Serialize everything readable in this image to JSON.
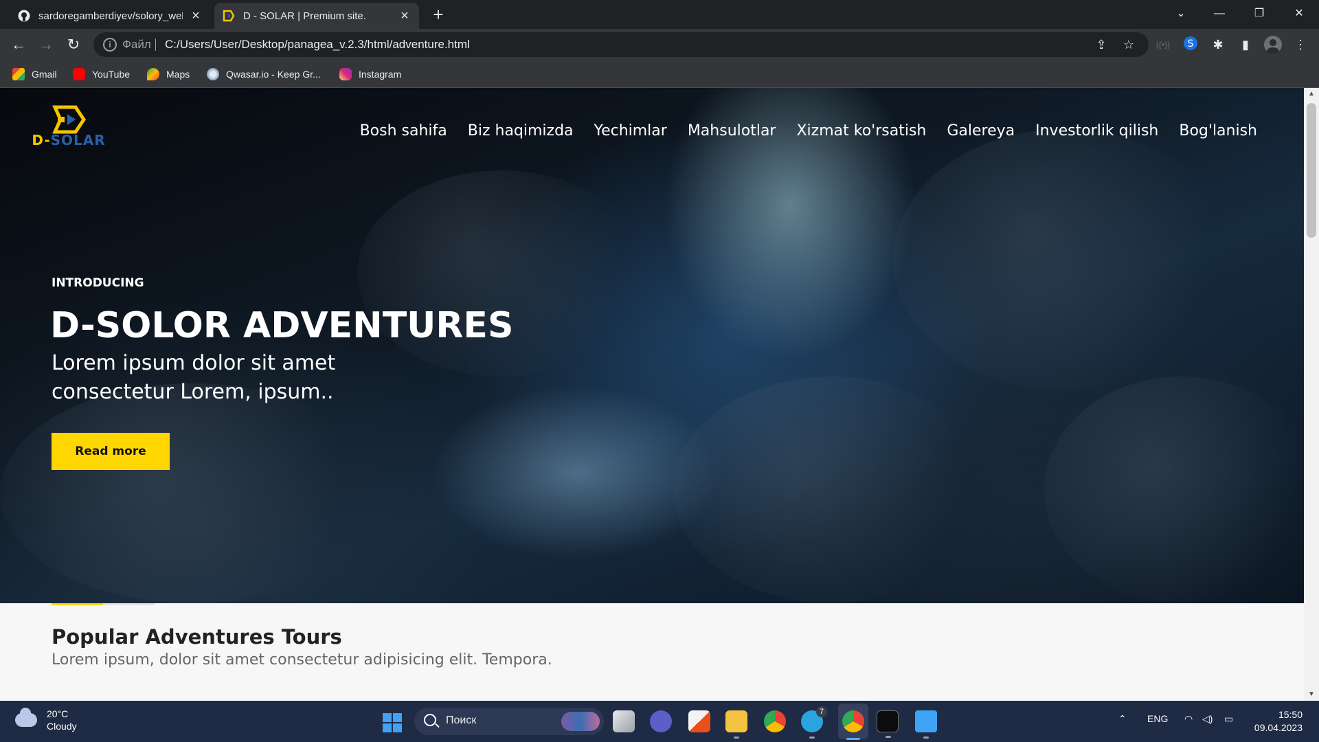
{
  "browser": {
    "tabs": [
      {
        "title": "sardoregamberdiyev/solory_web",
        "active": false
      },
      {
        "title": "D - SOLAR | Premium site.",
        "active": true
      }
    ],
    "omnibox": {
      "scheme_label": "Файл",
      "url": "C:/Users/User/Desktop/panagea_v.2.3/html/adventure.html"
    },
    "bookmarks": [
      {
        "label": "Gmail",
        "icon": "gmail-icon"
      },
      {
        "label": "YouTube",
        "icon": "youtube-icon"
      },
      {
        "label": "Maps",
        "icon": "maps-icon"
      },
      {
        "label": "Qwasar.io - Keep Gr...",
        "icon": "qwasar-icon"
      },
      {
        "label": "Instagram",
        "icon": "instagram-icon"
      }
    ]
  },
  "site": {
    "logo_text_primary": "D-",
    "logo_text_secondary": "SOLAR",
    "nav": [
      "Bosh sahifa",
      "Biz haqimizda",
      "Yechimlar",
      "Mahsulotlar",
      "Xizmat ko'rsatish",
      "Galereya",
      "Investorlik qilish",
      "Bog'lanish"
    ],
    "hero": {
      "eyebrow": "INTRODUCING",
      "title": "D-SOLOR ADVENTURES",
      "subtitle": "Lorem ipsum dolor sit amet consectetur Lorem, ipsum..",
      "button": "Read more"
    },
    "slider_progress": 0.5,
    "section": {
      "title": "Popular Adventures Tours",
      "subtitle": "Lorem ipsum, dolor sit amet consectetur adipisicing elit. Tempora."
    }
  },
  "taskbar": {
    "weather": {
      "temp": "20°C",
      "condition": "Cloudy"
    },
    "search_label": "Поиск",
    "telegram_badge": "7",
    "language": "ENG",
    "time": "15:50",
    "date": "09.04.2023"
  },
  "colors": {
    "accent_yellow": "#ffd600",
    "browser_dark": "#202124",
    "browser_toolbar": "#35363a",
    "taskbar": "#1f2a44"
  }
}
